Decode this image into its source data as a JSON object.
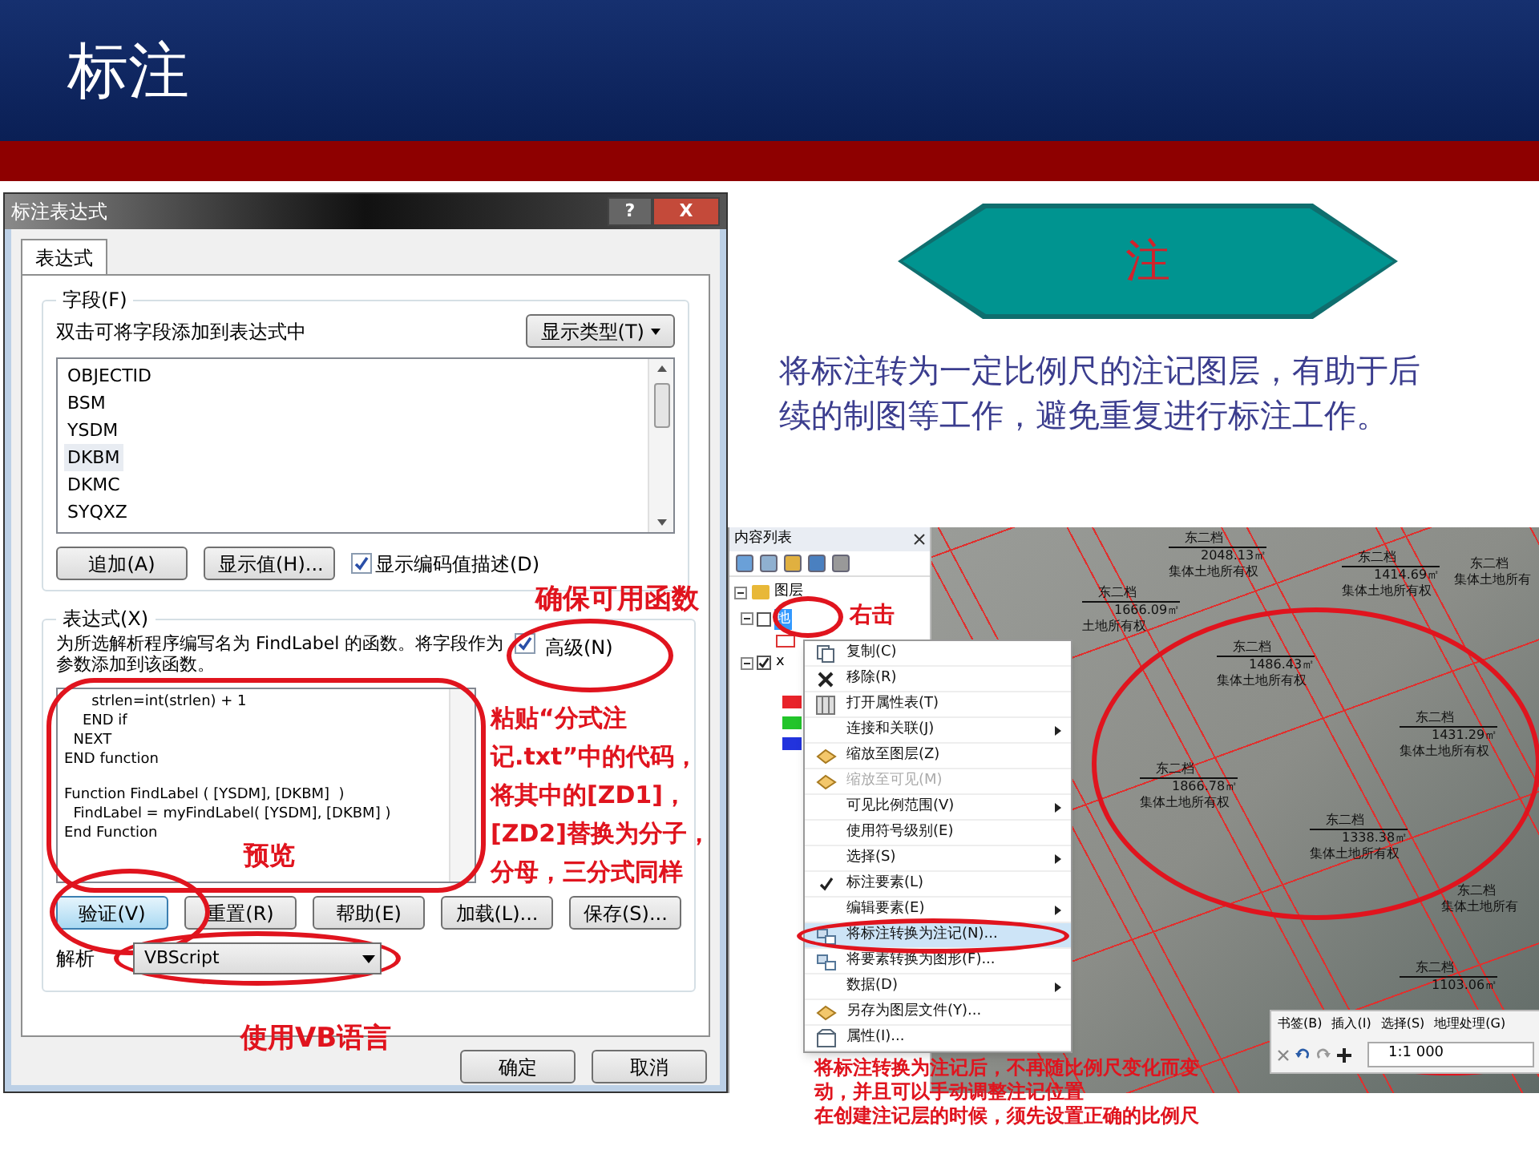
{
  "slide": {
    "title": "标注"
  },
  "dialog": {
    "title": "标注表达式",
    "title_buttons": [
      "?",
      "X"
    ],
    "tabs": [
      {
        "label": "表达式",
        "selected": true
      }
    ],
    "fields_group": {
      "legend": "字段(F)",
      "hint": "双击可将字段添加到表达式中",
      "type_button": "显示类型(T)",
      "fields": [
        {
          "name": "OBJECTID",
          "selected": false
        },
        {
          "name": "BSM",
          "selected": false
        },
        {
          "name": "YSDM",
          "selected": false
        },
        {
          "name": "DKBM",
          "selected": true
        },
        {
          "name": "DKMC",
          "selected": false
        },
        {
          "name": "SYQXZ",
          "selected": false
        }
      ],
      "buttons": [
        "追加(A)",
        "显示值(H)..."
      ],
      "show_coded": {
        "label": "显示编码值描述(D)",
        "checked": true
      }
    },
    "expression_group": {
      "legend": "表达式(X)",
      "description": "为所选解析程序编写名为 FindLabel 的函数。将字段作为参数添加到该函数。",
      "advanced": {
        "label": "高级(N)",
        "checked": true
      },
      "code_blocks": [
        [
          "      strlen=int(strlen) + 1",
          "    END if",
          "  NEXT",
          "END function"
        ],
        [
          "Function FindLabel ( [YSDM], [DKBM]  )",
          "  FindLabel = myFindLabel( [YSDM], [DKBM] )",
          "End Function"
        ]
      ],
      "buttons": [
        {
          "label": "验证(V)",
          "focused": true
        },
        {
          "label": "重置(R)",
          "focused": false
        },
        {
          "label": "帮助(E)",
          "focused": false
        },
        {
          "label": "加载(L)...",
          "focused": false
        },
        {
          "label": "保存(S)...",
          "focused": false
        }
      ],
      "parser_label": "解析",
      "parser": "VBScript"
    },
    "footer_buttons": [
      "确定",
      "取消"
    ]
  },
  "dialog_notes": {
    "ensure": "确保可用函数",
    "paste": [
      "粘贴“分式注",
      "记.txt”中的代码，",
      "将其中的[ZD1]，",
      "[ZD2]替换为分子，",
      "分母，三分式同样"
    ],
    "preview": "预览",
    "language": "使用VB语言"
  },
  "badge_label": "注",
  "summary": "将标注转为一定比例尺的注记图层，有助于后续的制图等工作，避免重复进行标注工作。",
  "arcmap": {
    "toc": {
      "title": "内容列表",
      "root": {
        "label": "图层",
        "expanded": true
      },
      "layers": [
        {
          "label": "地",
          "checked": false,
          "selected": true,
          "expanded": true
        },
        {
          "label": "x",
          "checked": true,
          "selected": false,
          "expanded": true
        }
      ],
      "legend": [
        {
          "color": "#e8232a"
        },
        {
          "color": "#22c42a"
        },
        {
          "color": "#2233dd"
        }
      ]
    },
    "parcels": [
      {
        "name": "东二档",
        "area": "2048.13㎡",
        "owner": "集体土地所有权"
      },
      {
        "name": "东二档",
        "area": "1666.09㎡",
        "owner": "土地所有权"
      },
      {
        "name": "东二档",
        "area": "1414.69㎡",
        "owner": "集体土地所有权"
      },
      {
        "name": "东二档",
        "owner": "集体土地所有"
      },
      {
        "name": "东二档",
        "area": "1486.43㎡",
        "owner": "集体土地所有权"
      },
      {
        "name": "东二档",
        "area": "1431.29㎡",
        "owner": "集体土地所有权"
      },
      {
        "name": "东二档",
        "area": "1866.78㎡",
        "owner": "集体土地所有权"
      },
      {
        "name": "东二档",
        "area": "1338.38㎡",
        "owner": "集体土地所有权"
      },
      {
        "name": "东二档",
        "owner": "集体土地所有"
      },
      {
        "name": "东二档",
        "area": "1103.06㎡"
      }
    ],
    "menu": [
      {
        "label": "复制(C)",
        "kind": "copy",
        "disabled": false,
        "checked": false,
        "submenu": false,
        "selected": false
      },
      {
        "label": "移除(R)",
        "kind": "remove",
        "disabled": false,
        "checked": false,
        "submenu": false,
        "selected": false
      },
      {
        "label": "打开属性表(T)",
        "kind": "table",
        "disabled": false,
        "checked": false,
        "submenu": false,
        "selected": false
      },
      {
        "label": "连接和关联(J)",
        "kind": "plain",
        "disabled": false,
        "checked": false,
        "submenu": true,
        "selected": false
      },
      {
        "label": "缩放至图层(Z)",
        "kind": "zoom",
        "disabled": false,
        "checked": false,
        "submenu": false,
        "selected": false
      },
      {
        "label": "缩放至可见(M)",
        "kind": "zoom",
        "disabled": true,
        "checked": false,
        "submenu": false,
        "selected": false
      },
      {
        "label": "可见比例范围(V)",
        "kind": "plain",
        "disabled": false,
        "checked": false,
        "submenu": true,
        "selected": false
      },
      {
        "label": "使用符号级别(E)",
        "kind": "plain",
        "disabled": false,
        "checked": false,
        "submenu": false,
        "selected": false
      },
      {
        "label": "选择(S)",
        "kind": "plain",
        "disabled": false,
        "checked": false,
        "submenu": true,
        "selected": false
      },
      {
        "label": "标注要素(L)",
        "kind": "plain",
        "disabled": false,
        "checked": true,
        "submenu": false,
        "selected": false
      },
      {
        "label": "编辑要素(E)",
        "kind": "plain",
        "disabled": false,
        "checked": false,
        "submenu": true,
        "selected": false
      },
      {
        "label": "将标注转换为注记(N)...",
        "kind": "convert",
        "disabled": false,
        "checked": false,
        "submenu": false,
        "selected": true
      },
      {
        "label": "将要素转换为图形(F)...",
        "kind": "convert",
        "disabled": false,
        "checked": false,
        "submenu": false,
        "selected": false
      },
      {
        "label": "数据(D)",
        "kind": "plain",
        "disabled": false,
        "checked": false,
        "submenu": true,
        "selected": false
      },
      {
        "label": "另存为图层文件(Y)...",
        "kind": "save",
        "disabled": false,
        "checked": false,
        "submenu": false,
        "selected": false
      },
      {
        "label": "属性(I)...",
        "kind": "properties",
        "disabled": false,
        "checked": false,
        "submenu": false,
        "selected": false
      }
    ],
    "toolbar": {
      "menus": [
        "书签(B)",
        "插入(I)",
        "选择(S)",
        "地理处理(G)"
      ],
      "scale": "1:1 000"
    },
    "notes": {
      "right_click": "右击",
      "result": [
        "将标注转换为注记后，不再随比例尺变化而变",
        "动，并且可以手动调整注记位置",
        "在创建注记层的时候，须先设置正确的比例尺"
      ]
    }
  }
}
